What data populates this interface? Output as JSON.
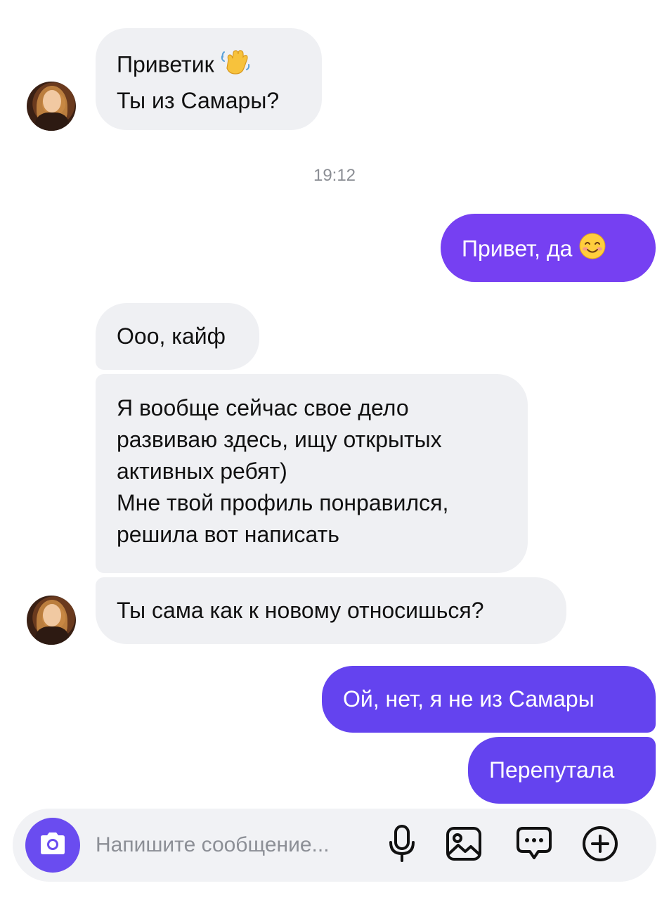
{
  "messages": {
    "m1": {
      "line1": "Приветик",
      "line2": "Ты из Самары?",
      "emoji": "waving-hand-emoji"
    },
    "time": "19:12",
    "m2": {
      "text": "Привет, да",
      "emoji": "smiling-face-emoji"
    },
    "m3": {
      "text": "Ооо, кайф"
    },
    "m4": {
      "line1": "Я вообще сейчас свое дело",
      "line2": "развиваю здесь, ищу открытых",
      "line3": "активных ребят)",
      "line4": "Мне твой профиль понравился,",
      "line5": "решила вот написать"
    },
    "m5": {
      "text": "Ты сама как к новому относишься?"
    },
    "m6": {
      "text": "Ой, нет, я не из Самары"
    },
    "m7": {
      "text": "Перепутала"
    }
  },
  "composer": {
    "placeholder": "Напишите сообщение...",
    "icons": [
      "camera-icon",
      "microphone-icon",
      "image-icon",
      "chat-bubble-icon",
      "plus-circle-icon"
    ]
  },
  "colors": {
    "incoming_bubble": "#eff0f3",
    "outgoing_bubble_1": "#7640f2",
    "outgoing_bubble_2": "#6443ef",
    "camera_button": "#6a4cf0",
    "composer_background": "#f1f2f5",
    "timestamp": "#8b8e94"
  }
}
